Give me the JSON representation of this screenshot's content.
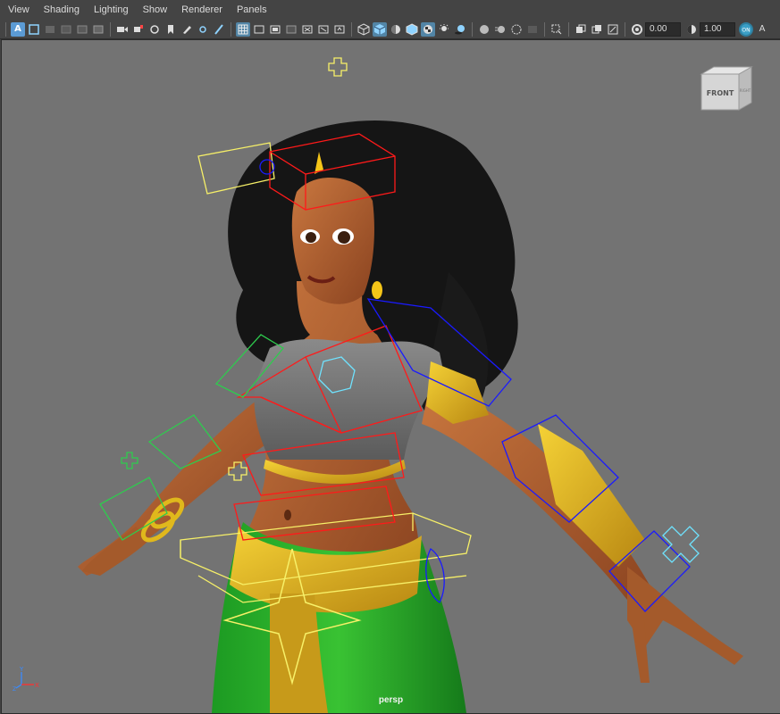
{
  "menu": {
    "items": [
      "View",
      "Shading",
      "Lighting",
      "Show",
      "Renderer",
      "Panels"
    ]
  },
  "toolbar": {
    "exposure_value": "0.00",
    "gamma_value": "1.00",
    "badge_letter": "A",
    "end_letter": "A"
  },
  "viewport": {
    "camera_name": "persp",
    "viewcube_label": "FRONT",
    "viewcube_side_label": "RIGHT",
    "axis_y": "Y",
    "axis_x": "X",
    "axis_z": "Z",
    "background_color": "#737373"
  },
  "colors": {
    "accent": "#5285a6",
    "ctrl_yellow": "#f7f068",
    "ctrl_red": "#ff1a1a",
    "ctrl_blue": "#1a1aff",
    "ctrl_green": "#2ecc4e",
    "ctrl_cyan": "#6fe3ff"
  }
}
